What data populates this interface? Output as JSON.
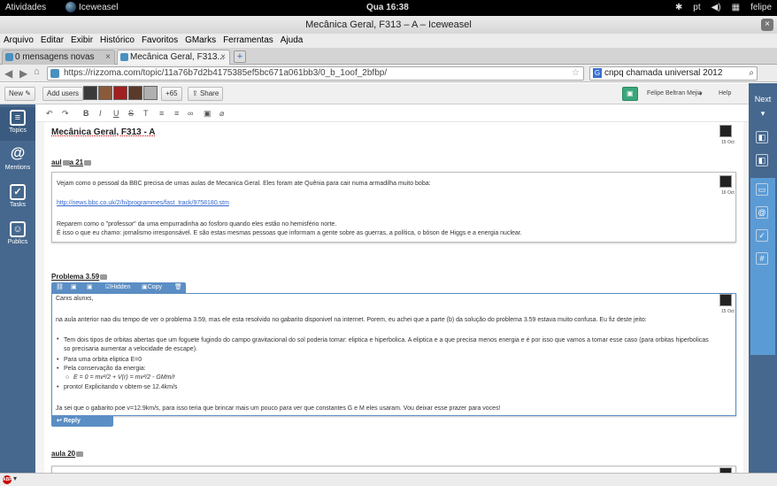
{
  "topbar": {
    "activities": "Atividades",
    "app": "Iceweasel",
    "clock": "Qua 16:38",
    "lang": "pt",
    "user": "felipe"
  },
  "window": {
    "title": "Mecânica Geral, F313 – A – Iceweasel",
    "close": "×"
  },
  "menu": [
    "Arquivo",
    "Editar",
    "Exibir",
    "Histórico",
    "Favoritos",
    "GMarks",
    "Ferramentas",
    "Ajuda"
  ],
  "tabs": [
    {
      "label": "0 mensagens novas"
    },
    {
      "label": "Mecânica Geral, F313..."
    }
  ],
  "tab_close": "×",
  "newtab": "+",
  "url": "https://rizzoma.com/topic/11a76b7d2b4175385ef5bc671a061bb3/0_b_1oof_2bfbp/",
  "url_star": "☆",
  "search": {
    "engine": "G",
    "value": "cnpq chamada universal 2012"
  },
  "appbar": {
    "new_label": "New",
    "add_users": "Add users",
    "more_count": "+65",
    "share": "Share",
    "user_name": "Felipe Beltran Mejia",
    "help": "Help",
    "next": "Next"
  },
  "leftnav": [
    {
      "label": "Topics",
      "icon": "list-icon"
    },
    {
      "label": "Mentions",
      "icon": "at-icon"
    },
    {
      "label": "Tasks",
      "icon": "check-icon"
    },
    {
      "label": "Publics",
      "icon": "people-icon"
    }
  ],
  "editor_tools": [
    "B",
    "I",
    "U",
    "S",
    "T",
    "≡",
    "≡",
    "∞",
    "▣",
    "⌀"
  ],
  "doc": {
    "title": "Mecânica Geral, F313 - A",
    "title_date": "15 Oct",
    "sections": [
      {
        "label_a": "aul",
        "label_b": "a 21"
      },
      {
        "label": "Problema 3.59"
      },
      {
        "label": "aula 20"
      }
    ],
    "card1": {
      "date": "16 Oct",
      "p1": "Vejam como  o pessoal da BBC precisa de umas aulas de Mecanica Geral. Eles foram ate Quênia para cair numa armadilha muito boba:",
      "link": "http://news.bbc.co.uk/2/hi/programmes/fast_track/9758180.stm",
      "p2": "Reparem como o \"professor\" da uma empurradinha ao fosforo quando eles estão no hemisfério norte.",
      "p3": "É isso o que eu chamo: jornalismo irresponsável. E são estas mesmas pessoas que informam a gente sobre as guerras, a política, o bóson de Higgs e a energia nuclear."
    },
    "card_toolbar": {
      "hidden": "Hidden",
      "copy": "Copy"
    },
    "card2": {
      "date": "15 Oct",
      "greeting": "Carxs alunxs,",
      "intro": "na aula anterior nao diu tempo de ver o problema 3.59, mas ele esta resolvido no gabarito disponivel na internet. Porem, eu achei que a parte (b) da solução do problema 3.59 estava muito confusa. Eu fiz deste jeito:",
      "b1": "Tem dois tipos de orbitas abertas que um foguete fugindo do campo gravitacional do sol poderia tomar: eliptica e hiperbolica. A eliptica e a que precisa menos energia e é por isso que vamos a tomar esse caso (para orbitas hiperbolicas so precisaria aumentar a velocidade de escape).",
      "b2": "Para uma orbita eliptica E=0",
      "b3": "Pela conservação da energia:",
      "formula": "E = 0 = mv²/2 + V(r) = mv²/2 - GMm/r",
      "b4": "pronto! Explicitando v obtem-se 12.4km/s",
      "outro": "Ja sei que o gabarito poe v=12.9km/s, para isso teria que brincar mais um pouco para ver que constantes G e M eles usaram. Vou deixar esse prazer para voces!",
      "reply": "Reply"
    }
  },
  "status": {
    "abp": "ABP",
    "chevron": "▾"
  }
}
